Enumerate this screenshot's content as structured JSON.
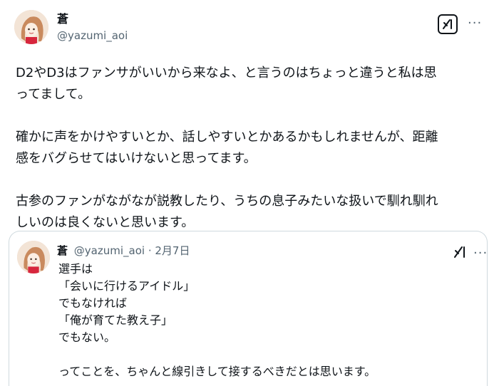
{
  "post": {
    "author_name": "蒼",
    "author_handle": "@yazumi_aoi",
    "paragraphs": [
      [
        "D2やD3はファンサがいいから来なよ、と言うのはちょっと違うと私は思",
        "ってまして。"
      ],
      [
        "確かに声をかけやすいとか、話しやすいとかあるかもしれませんが、距離",
        "感をバグらせてはいけないと思ってます。"
      ],
      [
        "古参のファンがながなが説教したり、うちの息子みたいな扱いで馴れ馴れ",
        "しいのは良くないと思います。"
      ]
    ],
    "icons": {
      "grok": "grok-icon",
      "more": "more-options-icon",
      "avatar": "profile-avatar"
    }
  },
  "quote": {
    "author_name": "蒼",
    "author_handle": "@yazumi_aoi",
    "separator": " · ",
    "date": "2月7日",
    "lines": [
      "選手は",
      "「会いに行けるアイドル」",
      "でもなければ",
      "「俺が育てた教え子」",
      "でもない。",
      "",
      "ってことを、ちゃんと線引きして接するべきだとは思います。"
    ]
  },
  "ui": {
    "more_glyph": "···",
    "colors": {
      "text": "#0f1419",
      "secondary": "#536471",
      "border": "#cfd9de"
    }
  }
}
